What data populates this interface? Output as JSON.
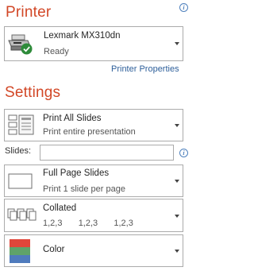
{
  "printer": {
    "title": "Printer",
    "name": "Lexmark MX310dn",
    "status": "Ready",
    "properties_link": "Printer Properties"
  },
  "settings": {
    "title": "Settings",
    "print_range": {
      "main": "Print All Slides",
      "sub": "Print entire presentation"
    },
    "slides_label": "Slides:",
    "slides_value": "",
    "layout": {
      "main": "Full Page Slides",
      "sub": "Print 1 slide per page"
    },
    "collation": {
      "main": "Collated",
      "sub": "1,2,3    1,2,3    1,2,3"
    },
    "color": {
      "main": "Color"
    }
  },
  "icons": {
    "info": "info-icon",
    "printer": "printer-icon",
    "ready_check": "ready-check-icon",
    "pages": "pages-icon",
    "full_page": "full-page-slide-icon",
    "collated": "collated-icon",
    "color": "color-swatch-icon",
    "caret": "chevron-down-icon"
  },
  "colors": {
    "accent": "#d24726",
    "link": "#2e5f9a",
    "border": "#ababab",
    "check_green": "#2e8b3a",
    "swatch_red": "#e0463a",
    "swatch_green": "#5fa36a",
    "swatch_blue": "#4f7bbd"
  }
}
